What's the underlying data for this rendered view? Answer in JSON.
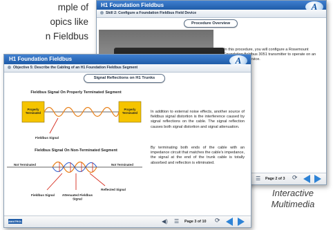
{
  "marketing": {
    "lines": [
      "mple of",
      "opics like",
      "n Fieldbus"
    ]
  },
  "back_screen": {
    "title": "H1 Foundation Fieldbus",
    "objective": "Skill 2: Configure a Foundation Fieldbus Field Device",
    "section": "Procedure Overview",
    "body": "In this procedure, you will configure a Rosemount Foundation fieldbus 3051 transmitter to operate on an H1 basic field device.",
    "page_label": "Page 2 of 3"
  },
  "front_screen": {
    "title": "H1 Foundation Fieldbus",
    "objective": "Objective 5: Describe the Cabling of an H1 Foundation Fieldbus Segment",
    "section": "Signal Reflections on H1 Trunks",
    "top_diagram": {
      "title": "Fieldbus Signal On Properly Terminated Segment",
      "left_box": "Properly Terminated",
      "right_box": "Properly Terminated",
      "signal_label": "Fieldbus Signal"
    },
    "bottom_diagram": {
      "title": "Fieldbus Signal On Non-Terminated Segment",
      "left_label": "Not Terminated",
      "right_label": "Not Terminated",
      "signal_label": "Fieldbus Signal",
      "attenuated_label": "Attenuated Fieldbus Signal",
      "reflected_label": "Reflected Signal"
    },
    "paragraph1": "In addition to external noise effects, another source of fieldbus signal distortion is the interference caused by signal reflections on the cable. The signal reflection causes both signal distortion and signal attenuation.",
    "paragraph2": "By terminating both ends of the cable with an impedance circuit that matches the cable's impedance, the signal at the end of the trunk cable is totally absorbed and reflection is eliminated.",
    "page_label": "Page 3 of 10",
    "brand": "AMATROL"
  },
  "caption": {
    "line1": "Interactive",
    "line2": "Multimedia"
  },
  "colors": {
    "title_bar": "#2b6cc0",
    "accent": "#2e83d6",
    "box_yellow": "#f5c400",
    "signal_orange": "#e8821c",
    "reflect_red": "#d62a1c"
  },
  "icons": {
    "logo": "A",
    "volume": "speaker-icon",
    "menu": "menu-icon",
    "refresh": "refresh-icon",
    "prev": "prev-arrow-icon",
    "next": "next-arrow-icon"
  }
}
